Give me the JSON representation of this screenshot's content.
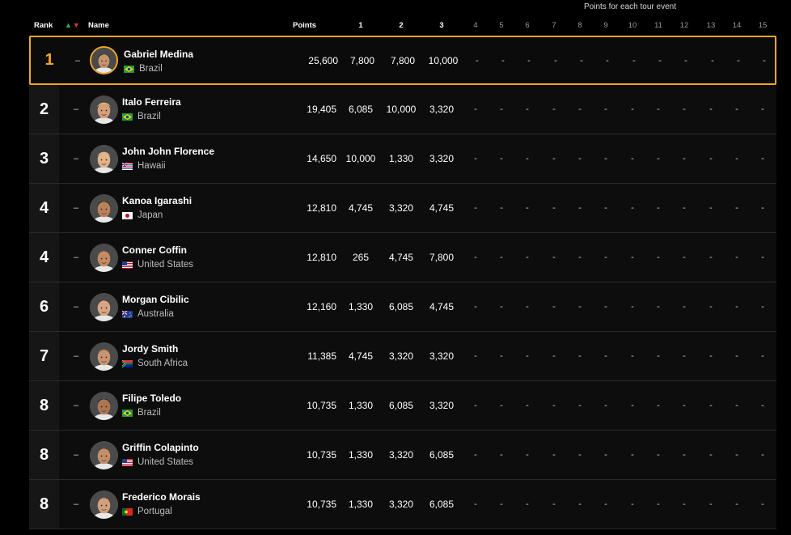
{
  "super_header": "Points for each tour event",
  "headers": {
    "rank": "Rank",
    "arrow_up": "▲",
    "arrow_down": "▼",
    "name": "Name",
    "points": "Points",
    "events": [
      "1",
      "2",
      "3",
      "4",
      "5",
      "6",
      "7",
      "8",
      "9",
      "10",
      "11",
      "12",
      "13",
      "14",
      "15"
    ]
  },
  "colors": {
    "accent": "#f5a623",
    "up": "#2fb34d",
    "down": "#e03535"
  },
  "rows": [
    {
      "rank": "1",
      "move": "–",
      "name": "Gabriel Medina",
      "country": "Brazil",
      "flag": "brazil",
      "points": "25,600",
      "e1": "7,800",
      "e2": "7,800",
      "e3": "10,000"
    },
    {
      "rank": "2",
      "move": "–",
      "name": "Italo Ferreira",
      "country": "Brazil",
      "flag": "brazil",
      "points": "19,405",
      "e1": "6,085",
      "e2": "10,000",
      "e3": "3,320"
    },
    {
      "rank": "3",
      "move": "–",
      "name": "John John Florence",
      "country": "Hawaii",
      "flag": "hawaii",
      "points": "14,650",
      "e1": "10,000",
      "e2": "1,330",
      "e3": "3,320"
    },
    {
      "rank": "4",
      "move": "–",
      "name": "Kanoa Igarashi",
      "country": "Japan",
      "flag": "japan",
      "points": "12,810",
      "e1": "4,745",
      "e2": "3,320",
      "e3": "4,745"
    },
    {
      "rank": "4",
      "move": "–",
      "name": "Conner Coffin",
      "country": "United States",
      "flag": "usa",
      "points": "12,810",
      "e1": "265",
      "e2": "4,745",
      "e3": "7,800"
    },
    {
      "rank": "6",
      "move": "–",
      "name": "Morgan Cibilic",
      "country": "Australia",
      "flag": "australia",
      "points": "12,160",
      "e1": "1,330",
      "e2": "6,085",
      "e3": "4,745"
    },
    {
      "rank": "7",
      "move": "–",
      "name": "Jordy Smith",
      "country": "South Africa",
      "flag": "south-africa",
      "points": "11,385",
      "e1": "4,745",
      "e2": "3,320",
      "e3": "3,320"
    },
    {
      "rank": "8",
      "move": "–",
      "name": "Filipe Toledo",
      "country": "Brazil",
      "flag": "brazil",
      "points": "10,735",
      "e1": "1,330",
      "e2": "6,085",
      "e3": "3,320"
    },
    {
      "rank": "8",
      "move": "–",
      "name": "Griffin Colapinto",
      "country": "United States",
      "flag": "usa",
      "points": "10,735",
      "e1": "1,330",
      "e2": "3,320",
      "e3": "6,085"
    },
    {
      "rank": "8",
      "move": "–",
      "name": "Frederico Morais",
      "country": "Portugal",
      "flag": "portugal",
      "points": "10,735",
      "e1": "1,330",
      "e2": "3,320",
      "e3": "6,085"
    }
  ],
  "empty_event_value": "-"
}
